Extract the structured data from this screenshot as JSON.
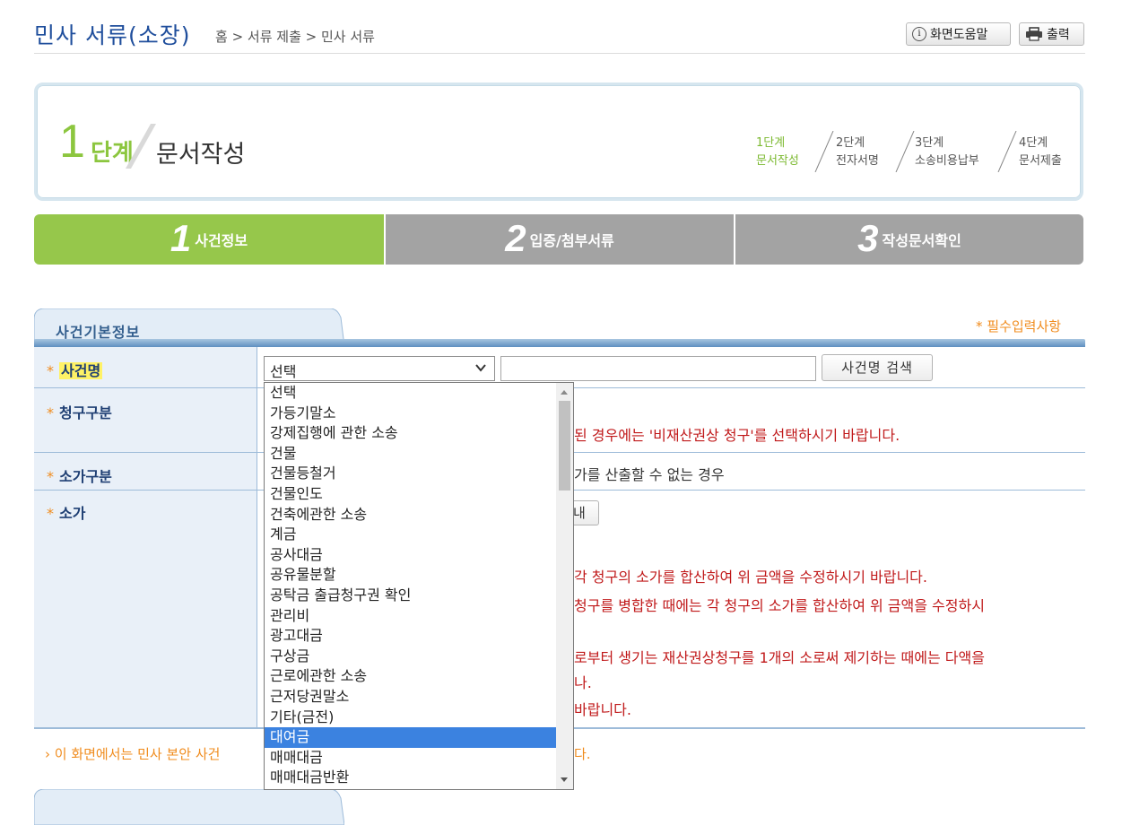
{
  "header": {
    "title": "민사 서류(소장)",
    "breadcrumb": "홈 > 서류 제출 > 민사 서류",
    "help_label": "화면도움말",
    "print_label": "출력"
  },
  "step_box": {
    "number": "1",
    "unit": "단계",
    "title": "문서작성",
    "steps": [
      {
        "line1": "1단계",
        "line2": "문서작성"
      },
      {
        "line1": "2단계",
        "line2": "전자서명"
      },
      {
        "line1": "3단계",
        "line2": "소송비용납부"
      },
      {
        "line1": "4단계",
        "line2": "문서제출"
      }
    ],
    "active_color": "#8cc63f"
  },
  "tabs": [
    {
      "num": "1",
      "label": "사건정보",
      "color": "#96c74b"
    },
    {
      "num": "2",
      "label": "입증/첨부서류",
      "color": "#a3a3a3"
    },
    {
      "num": "3",
      "label": "작성문서확인",
      "color": "#a3a3a3"
    }
  ],
  "section": {
    "title": "사건기본정보",
    "required_note": "* 필수입력사항"
  },
  "form": {
    "labels": {
      "case_name": "사건명",
      "claim_type": "청구구분",
      "value_type": "소가구분",
      "value": "소가",
      "star": "*"
    },
    "case_select_value": "선택",
    "case_search_button": "사건명 검색",
    "amount_button_fragment": "내",
    "claim_note_fragment": "된 경우에는 '비재산권상 청구'를 선택하시기 바랍니다.",
    "value_type_fragment": "가를 산출할 수 없는 경우",
    "value_notes": [
      "각 청구의 소가를 합산하여 위 금액을 수정하시기 바랍니다.",
      "청구를 병합한 때에는 각 청구의 소가를 합산하여 위 금액을 수정하시",
      "로부터 생기는 재산권상청구를 1개의 소로써 제기하는 때에는 다액을",
      "나.",
      "바랍니다."
    ]
  },
  "bottom_note": "› 이 화면에서는 민사 본안 사건",
  "bottom_note_tail": "다.",
  "dropdown": {
    "selected_index": 17,
    "options": [
      "선택",
      "가등기말소",
      "강제집행에 관한 소송",
      "건물",
      "건물등철거",
      "건물인도",
      "건축에관한 소송",
      "계금",
      "공사대금",
      "공유물분할",
      "공탁금 출급청구권 확인",
      "관리비",
      "광고대금",
      "구상금",
      "근로에관한 소송",
      "근저당권말소",
      "기타(금전)",
      "대여금",
      "매매대금",
      "매매대금반환"
    ]
  },
  "colors": {
    "title_blue": "#1f4e9c",
    "accent_orange": "#f08c1e",
    "note_red": "#c0191a",
    "selected_blue": "#3b82e0"
  }
}
